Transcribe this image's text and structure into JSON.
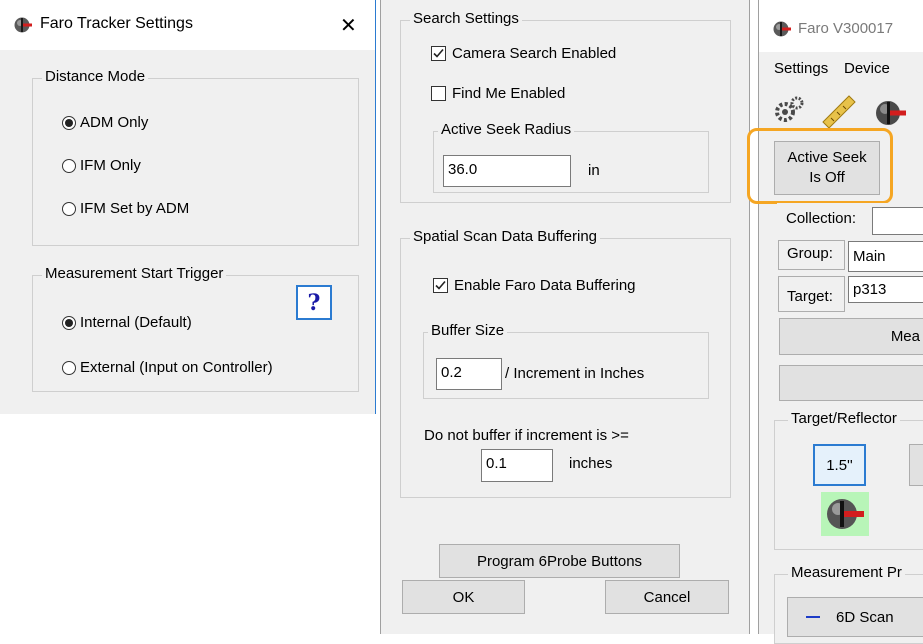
{
  "dialog1": {
    "title": "Faro Tracker Settings",
    "close_glyph": "✕",
    "distance_mode": {
      "label": "Distance Mode",
      "options": [
        "ADM Only",
        "IFM Only",
        "IFM Set by ADM"
      ],
      "selected": "ADM Only"
    },
    "trigger": {
      "label": "Measurement Start Trigger",
      "options": [
        "Internal (Default)",
        "External (Input on Controller)"
      ],
      "selected": "Internal (Default)",
      "help_label": "?"
    }
  },
  "dialog2": {
    "search": {
      "label": "Search Settings",
      "camera_search_label": "Camera Search Enabled",
      "camera_search_checked": true,
      "find_me_label": "Find Me Enabled",
      "find_me_checked": false,
      "seek_radius_label": "Active Seek Radius",
      "seek_radius_value": "36.0",
      "seek_radius_unit": "in"
    },
    "buffering": {
      "label": "Spatial Scan Data Buffering",
      "enable_label": "Enable Faro Data Buffering",
      "enable_checked": true,
      "buffer_size_label": "Buffer Size",
      "buffer_size_value": "0.2",
      "buffer_size_unit": "/ Increment in Inches",
      "threshold_label": "Do not buffer if increment is >=",
      "threshold_value": "0.1",
      "threshold_unit": "inches"
    },
    "program_button": "Program 6Probe Buttons",
    "ok_button": "OK",
    "cancel_button": "Cancel"
  },
  "dialog3": {
    "title": "Faro V300017",
    "menu": [
      "Settings",
      "Device"
    ],
    "active_seek_button": "Active Seek\nIs Off",
    "collection_label": "Collection:",
    "group_label": "Group:",
    "group_value": "Main",
    "target_label": "Target:",
    "target_value": "p313",
    "measure_button": "Mea",
    "reflector_label": "Target/Reflector",
    "reflector_size": "1.5''",
    "measurement_label": "Measurement Pr",
    "scan_button": "6D Scan",
    "highlight_color": "#f5a623",
    "icons": [
      "tracker-icon",
      "gears-icon",
      "ruler-icon",
      "tracker-icon"
    ]
  }
}
